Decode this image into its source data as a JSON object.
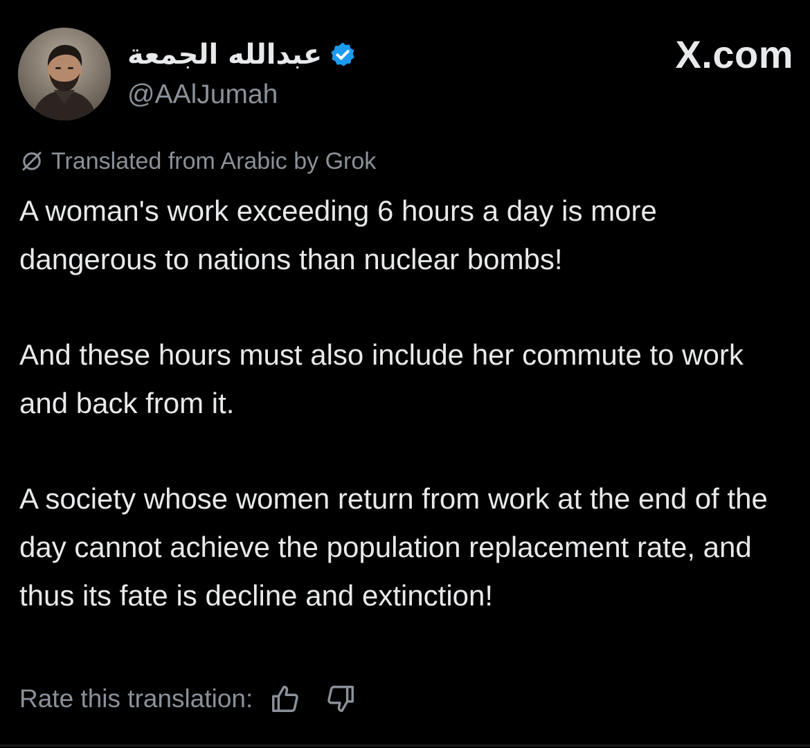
{
  "header": {
    "display_name": "عبدالله الجمعة",
    "handle": "@AAlJumah",
    "brand": "X.com",
    "verified_color": "#1d9bf0",
    "avatar_icon": "avatar-photo"
  },
  "translation": {
    "label": "Translated from Arabic by Grok",
    "icon": "grok-slash-icon"
  },
  "tweet": {
    "paragraphs": [
      "A woman's work exceeding 6 hours a day is more dangerous to nations than nuclear bombs!",
      "And these hours must also include her commute to work and back from it.",
      "A society whose women return from work at the end of the day cannot achieve the population replacement rate, and thus its fate is decline and extinction!"
    ]
  },
  "rating": {
    "label": "Rate this translation:",
    "thumbs_up_icon": "thumbs-up-icon",
    "thumbs_down_icon": "thumbs-down-icon"
  },
  "colors": {
    "background": "#000000",
    "primary_text": "#e7e9ea",
    "secondary_text": "#8b9199",
    "accent": "#1d9bf0"
  }
}
